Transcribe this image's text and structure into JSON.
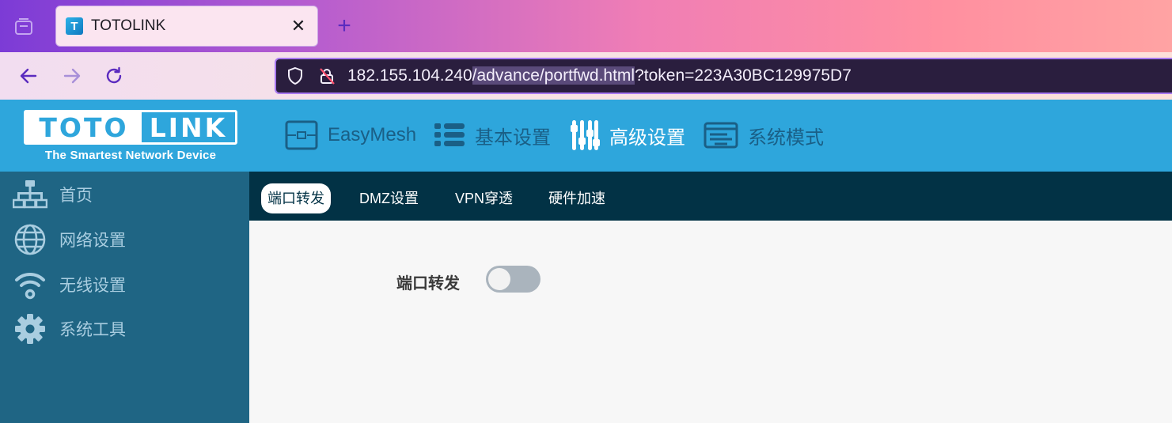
{
  "browser": {
    "tab_title": "TOTOLINK",
    "tab_favicon_letter": "T",
    "tab_close": "✕",
    "new_tab": "+",
    "url_host": "182.155.104.240",
    "url_path": "/advance/portfwd.html",
    "url_query": "?token=223A30BC129975D7",
    "accent_color": "#a778f0"
  },
  "brand": {
    "logo_left": "TOTO",
    "logo_right": "LINK",
    "tagline": "The Smartest Network Device",
    "header_color": "#2ea6dc"
  },
  "topnav": {
    "items": [
      {
        "label": "EasyMesh",
        "icon": "easymesh-icon",
        "active": false
      },
      {
        "label": "基本设置",
        "icon": "list-icon",
        "active": false
      },
      {
        "label": "高级设置",
        "icon": "sliders-icon",
        "active": true
      },
      {
        "label": "系统模式",
        "icon": "system-mode-icon",
        "active": false
      }
    ]
  },
  "sidebar": {
    "items": [
      {
        "label": "首页",
        "icon": "network-topology-icon"
      },
      {
        "label": "网络设置",
        "icon": "globe-icon"
      },
      {
        "label": "无线设置",
        "icon": "wifi-icon"
      },
      {
        "label": "系统工具",
        "icon": "gear-icon"
      }
    ],
    "color": "#1f6584"
  },
  "subnav": {
    "tabs": [
      {
        "label": "端口转发",
        "active": true
      },
      {
        "label": "DMZ设置",
        "active": false
      },
      {
        "label": "VPN穿透",
        "active": false
      },
      {
        "label": "硬件加速",
        "active": false
      }
    ],
    "color": "#023245"
  },
  "content": {
    "port_forward_label": "端口转发",
    "port_forward_enabled": false
  }
}
